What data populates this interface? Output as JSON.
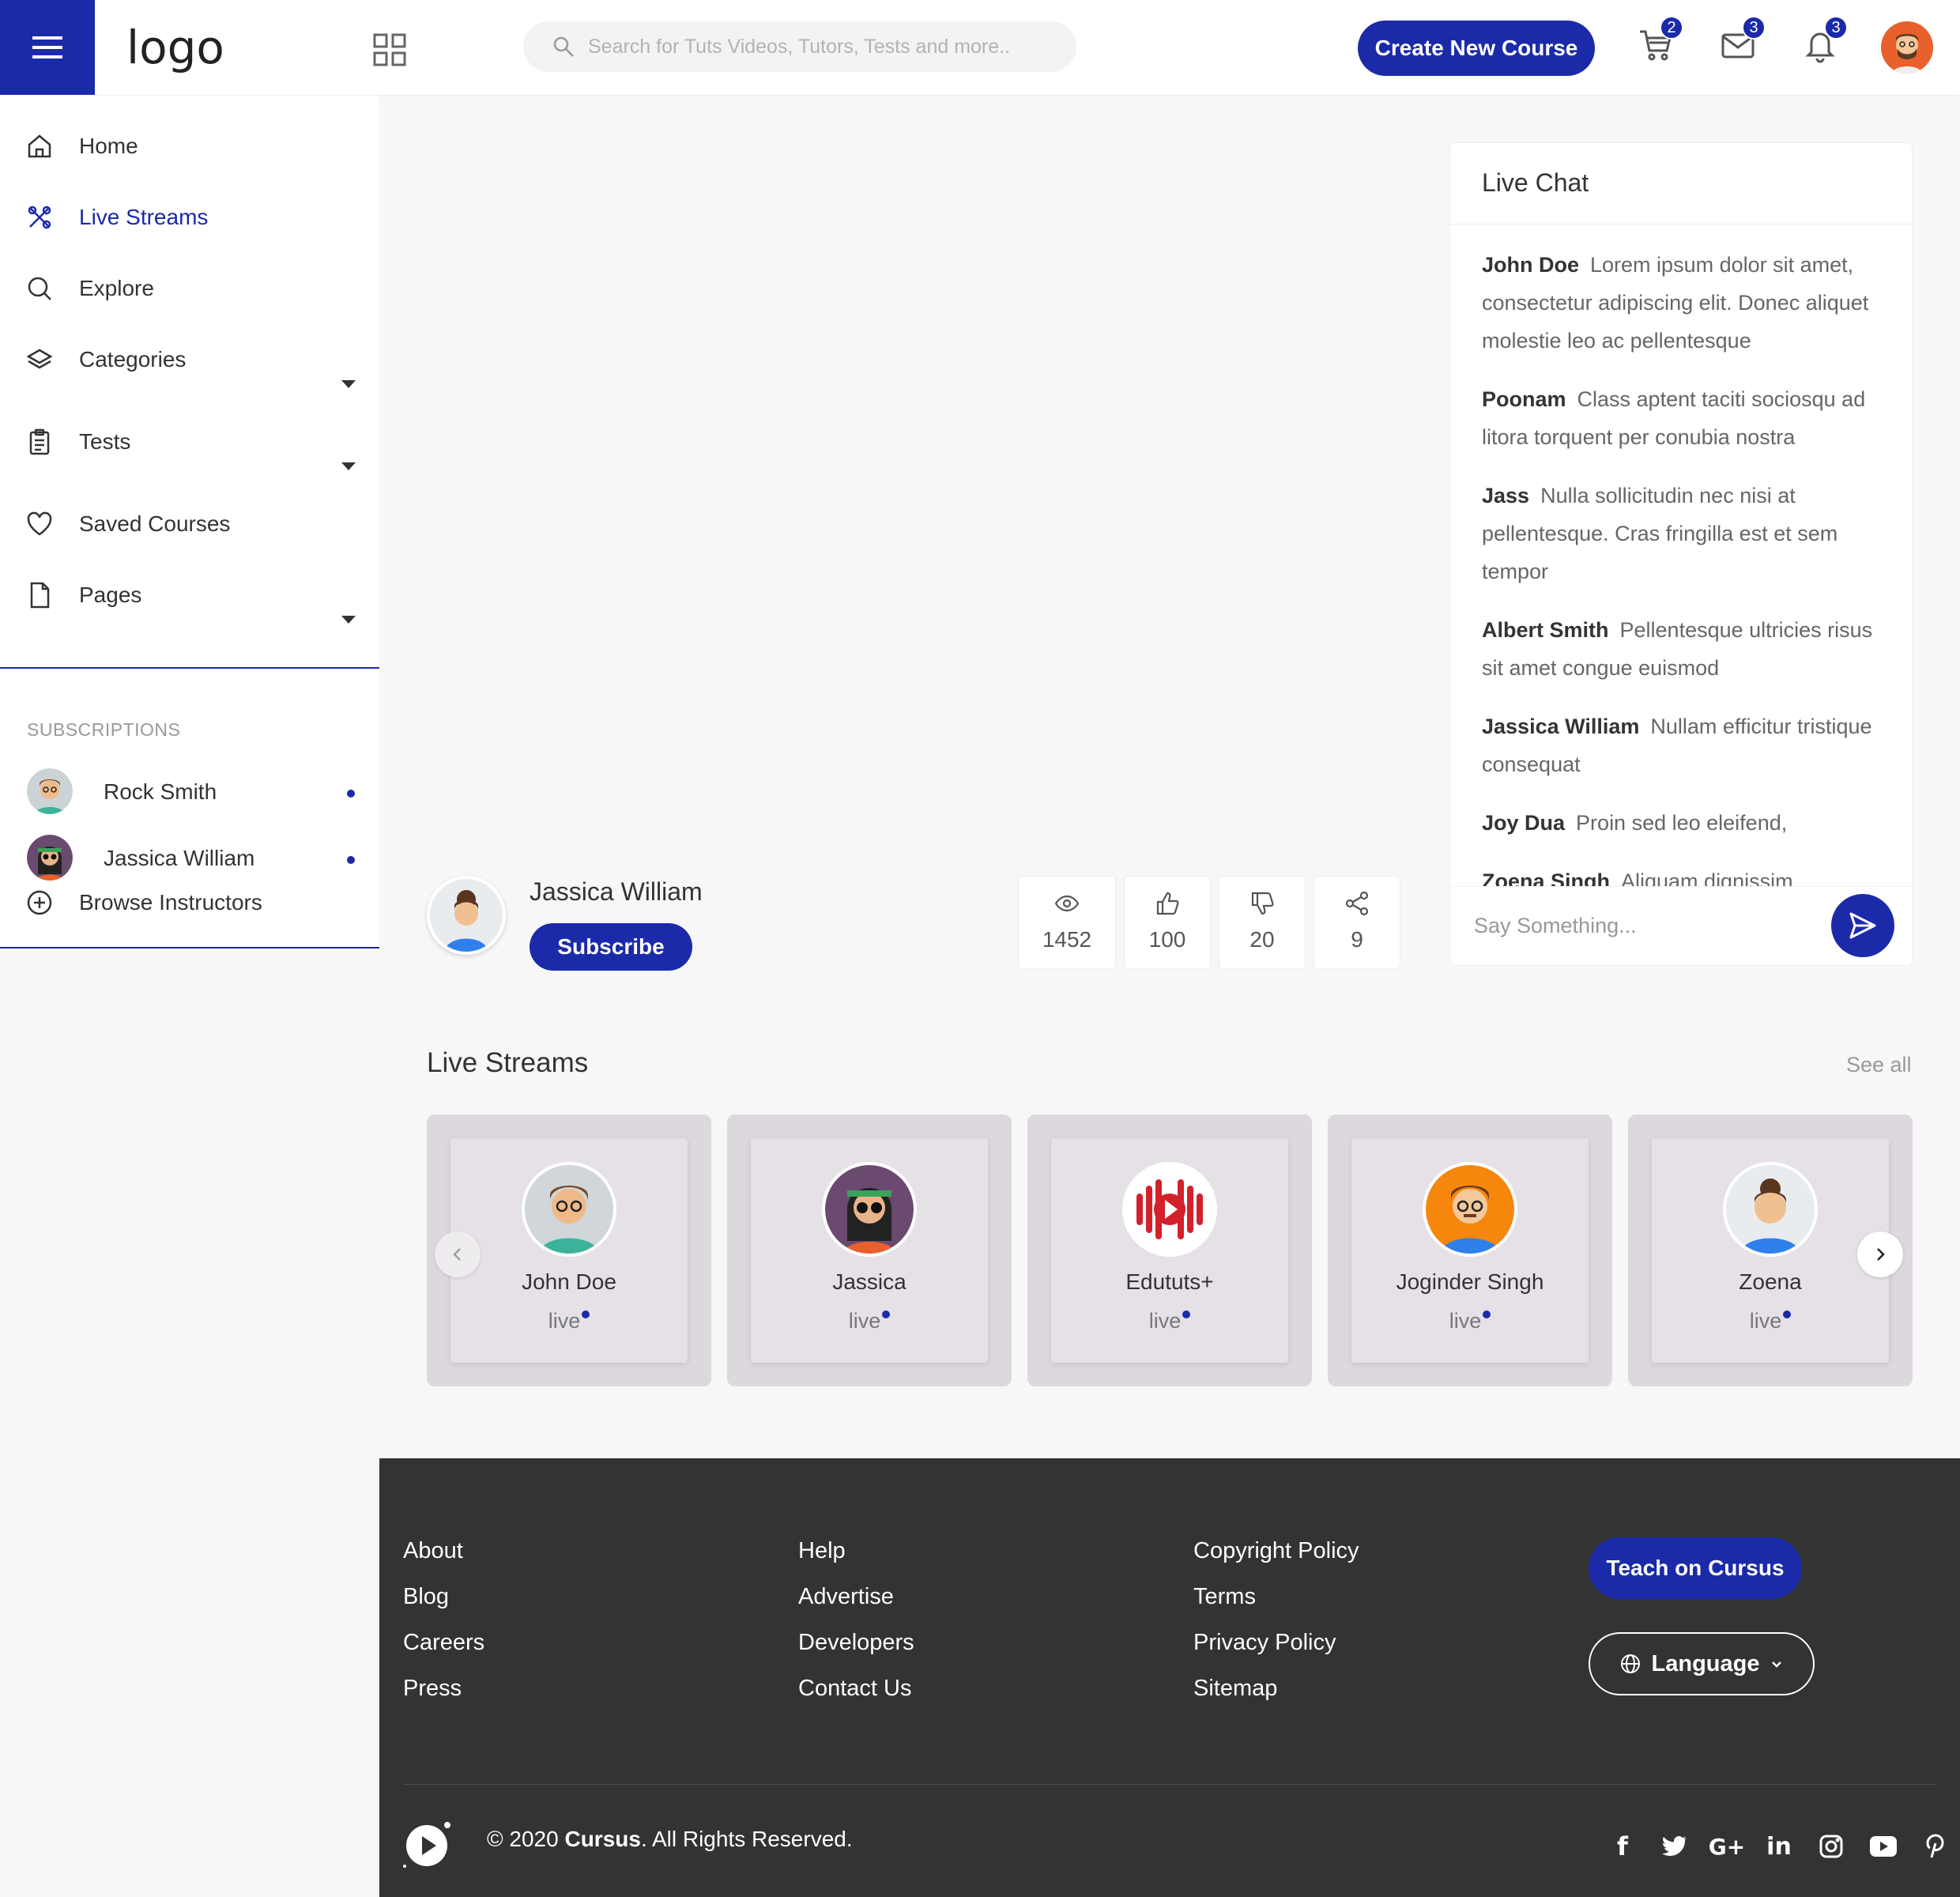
{
  "header": {
    "logo_text": "logo",
    "search_placeholder": "Search for Tuts Videos, Tutors, Tests and more..",
    "create_button": "Create New Course",
    "cart_count": "2",
    "messages_count": "3",
    "notifications_count": "3"
  },
  "sidebar": {
    "items": [
      {
        "label": "Home",
        "icon": "home-icon"
      },
      {
        "label": "Live Streams",
        "icon": "live-stream-icon"
      },
      {
        "label": "Explore",
        "icon": "search-icon"
      },
      {
        "label": "Categories",
        "icon": "layers-icon"
      },
      {
        "label": "Tests",
        "icon": "clipboard-icon"
      },
      {
        "label": "Saved Courses",
        "icon": "heart-icon"
      },
      {
        "label": "Pages",
        "icon": "file-icon"
      }
    ],
    "subscriptions_title": "SUBSCRIPTIONS",
    "subscriptions": [
      {
        "name": "Rock Smith"
      },
      {
        "name": "Jassica William"
      }
    ],
    "browse_label": "Browse Instructors"
  },
  "stream": {
    "streamer_name": "Jassica William",
    "subscribe_label": "Subscribe",
    "views": "1452",
    "likes": "100",
    "dislikes": "20",
    "shares": "9"
  },
  "chat": {
    "title": "Live Chat",
    "messages": [
      {
        "user": "John Doe",
        "text": "Lorem ipsum dolor sit amet, consectetur adipiscing elit. Donec aliquet molestie leo ac pellentesque"
      },
      {
        "user": "Poonam",
        "text": "Class aptent taciti sociosqu ad litora torquent per conubia nostra"
      },
      {
        "user": "Jass",
        "text": "Nulla sollicitudin nec nisi at pellentesque. Cras fringilla est et sem tempor"
      },
      {
        "user": "Albert Smith",
        "text": "Pellentesque ultricies risus sit amet congue euismod"
      },
      {
        "user": "Jassica William",
        "text": "Nullam efficitur tristique consequat"
      },
      {
        "user": "Joy Dua",
        "text": "Proin sed leo eleifend,"
      },
      {
        "user": "Zoena Singh",
        "text": "Aliquam dignissim"
      }
    ],
    "input_placeholder": "Say Something..."
  },
  "live_streams": {
    "title": "Live Streams",
    "see_all": "See all",
    "cards": [
      {
        "name": "John Doe",
        "status": "live"
      },
      {
        "name": "Jassica",
        "status": "live"
      },
      {
        "name": "Edututs+",
        "status": "live"
      },
      {
        "name": "Joginder Singh",
        "status": "live"
      },
      {
        "name": "Zoena",
        "status": "live"
      }
    ]
  },
  "footer": {
    "col1": [
      "About",
      "Blog",
      "Careers",
      "Press"
    ],
    "col2": [
      "Help",
      "Advertise",
      "Developers",
      "Contact Us"
    ],
    "col3": [
      "Copyright Policy",
      "Terms",
      "Privacy Policy",
      "Sitemap"
    ],
    "teach_button": "Teach on Cursus",
    "language_button": "Language",
    "copyright_prefix": "© 2020",
    "copyright_brand": "Cursus",
    "copyright_suffix": ". All Rights Reserved.",
    "socials": [
      "facebook-icon",
      "twitter-icon",
      "google-plus-icon",
      "linkedin-icon",
      "instagram-icon",
      "youtube-icon",
      "pinterest-icon"
    ]
  },
  "colors": {
    "accent": "#1b2aa8",
    "footer_bg": "#333333",
    "card_bg": "#ddd8de"
  }
}
